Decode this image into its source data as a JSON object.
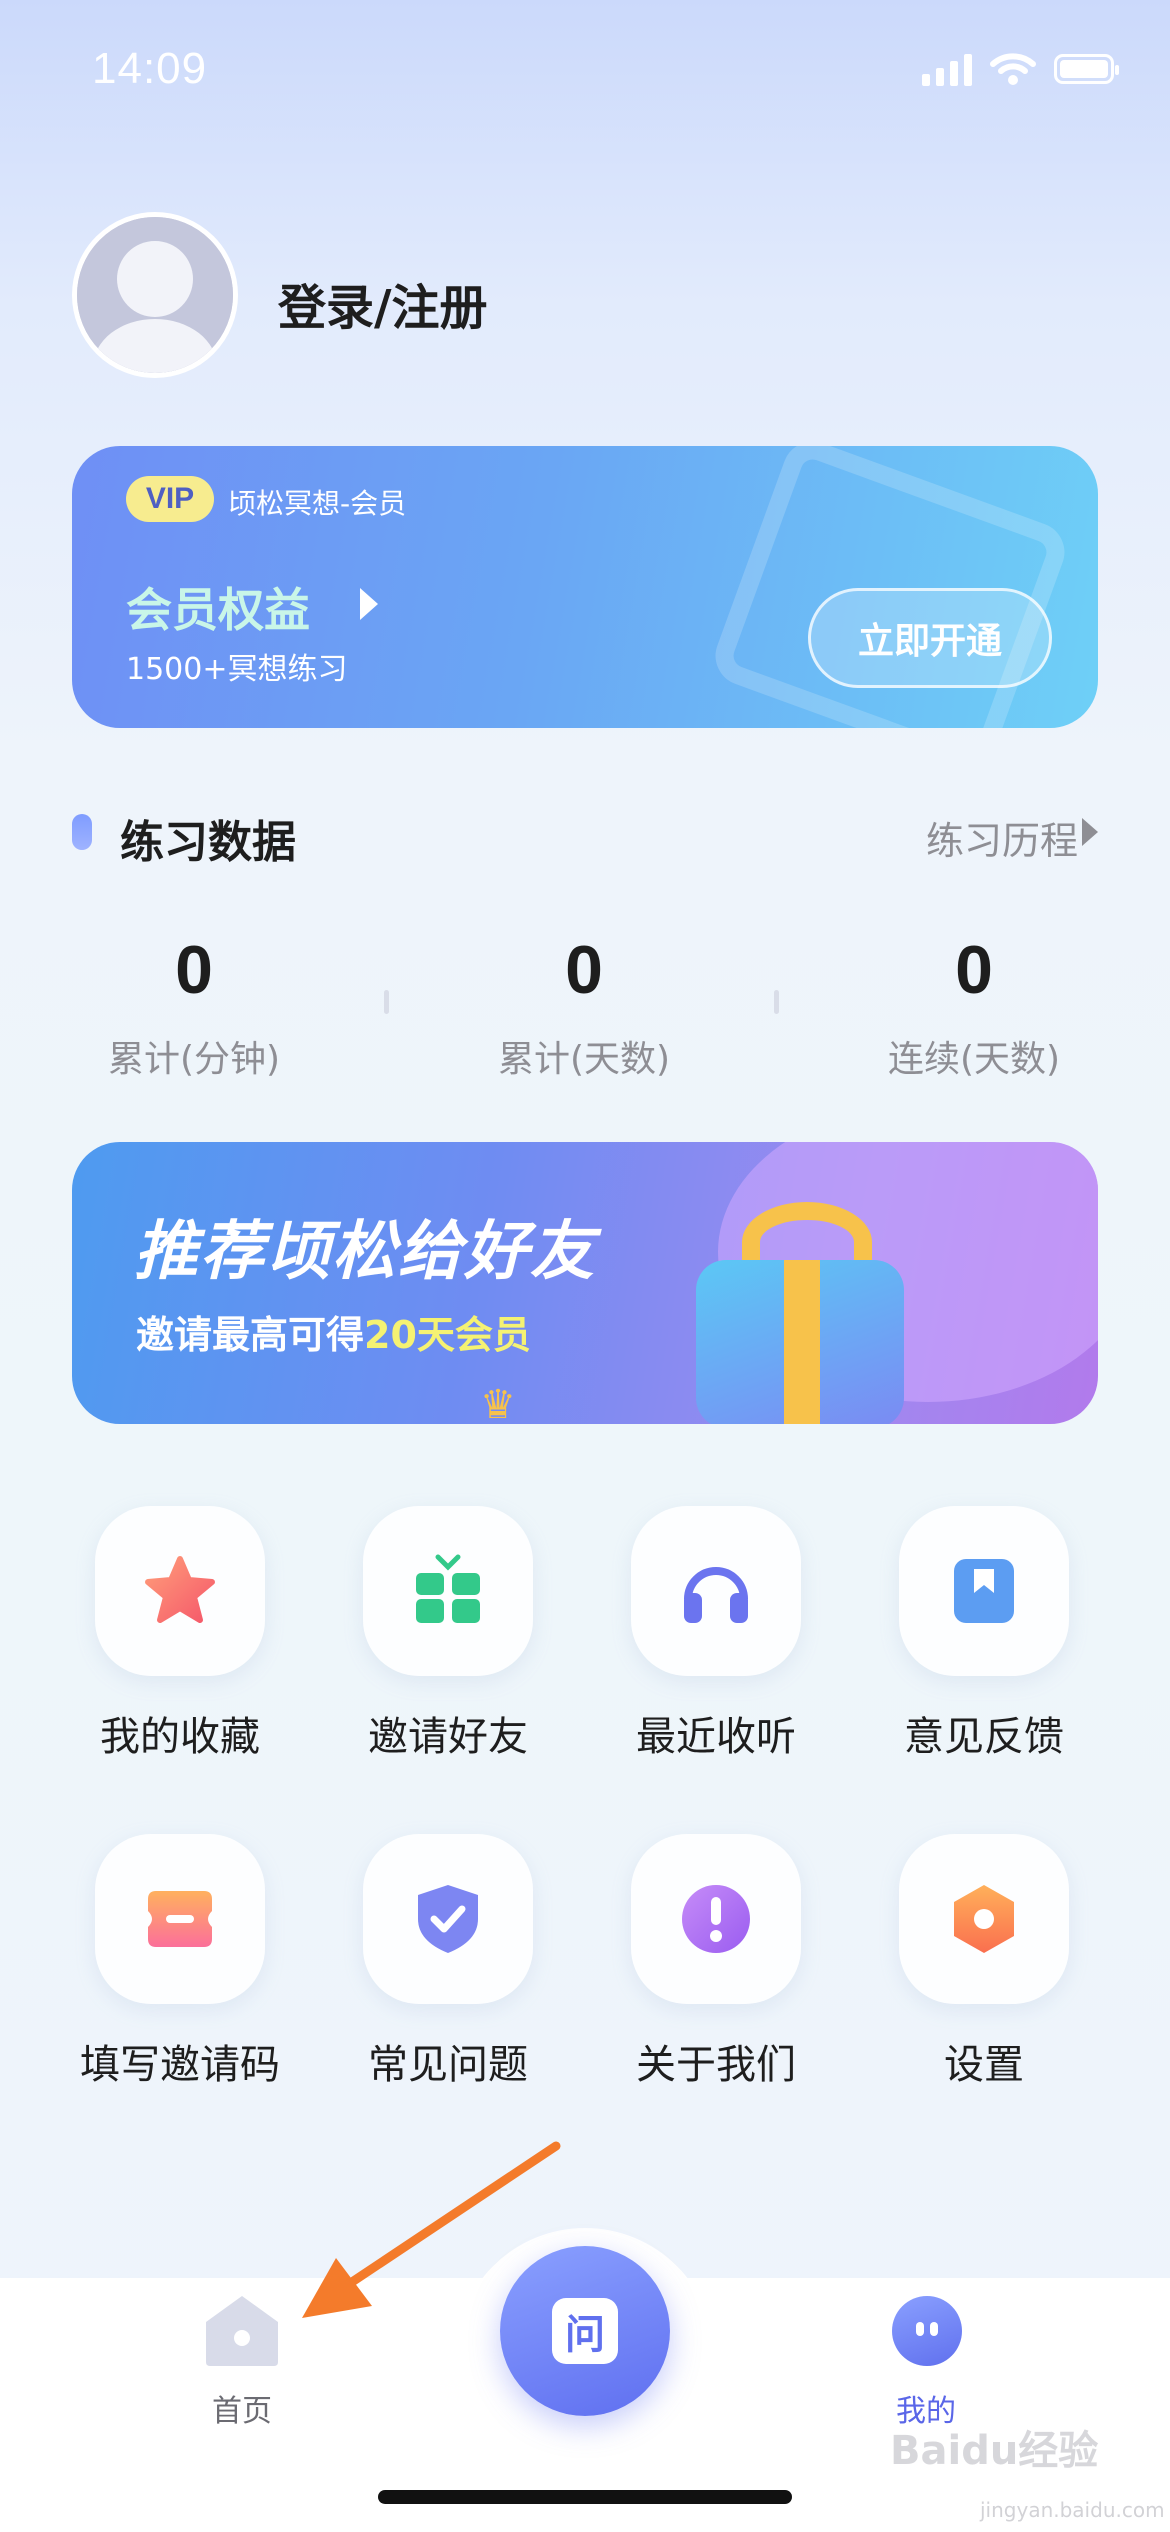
{
  "status_bar": {
    "time": "14:09"
  },
  "profile": {
    "login_text": "登录/注册"
  },
  "vip_card": {
    "badge": "VIP",
    "label": "顷松冥想-会员",
    "title": "会员权益",
    "subtitle": "1500+冥想练习",
    "button": "立即开通"
  },
  "practice": {
    "title": "练习数据",
    "history_link": "练习历程",
    "stats": [
      {
        "value": "0",
        "label": "累计(分钟)"
      },
      {
        "value": "0",
        "label": "累计(天数)"
      },
      {
        "value": "0",
        "label": "连续(天数)"
      }
    ]
  },
  "invite_banner": {
    "title": "推荐顷松给好友",
    "subtitle_prefix": "邀请最高可得",
    "subtitle_highlight": "20天会员"
  },
  "menu": [
    {
      "label": "我的收藏",
      "icon": "star-icon"
    },
    {
      "label": "邀请好友",
      "icon": "gift-grid-icon"
    },
    {
      "label": "最近收听",
      "icon": "headphones-icon"
    },
    {
      "label": "意见反馈",
      "icon": "bookmark-icon"
    },
    {
      "label": "填写邀请码",
      "icon": "ticket-icon"
    },
    {
      "label": "常见问题",
      "icon": "shield-check-icon"
    },
    {
      "label": "关于我们",
      "icon": "exclamation-icon"
    },
    {
      "label": "设置",
      "icon": "gear-hex-icon"
    }
  ],
  "tabbar": {
    "home_label": "首页",
    "center_glyph": "问",
    "mine_label": "我的"
  },
  "watermark": {
    "main": "Baidu经验",
    "sub": "jingyan.baidu.com"
  },
  "colors": {
    "accent": "#6070ee",
    "vip_highlight": "#f5f272",
    "text_muted": "#8e8e94"
  }
}
